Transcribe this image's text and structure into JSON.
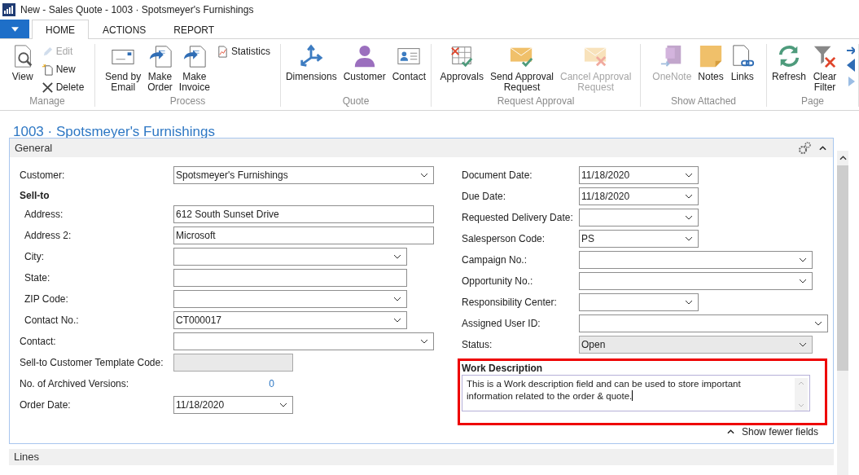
{
  "window": {
    "title": "New - Sales Quote - 1003 · Spotsmeyer's Furnishings"
  },
  "tabs": [
    {
      "label": "HOME",
      "selected": true
    },
    {
      "label": "ACTIONS",
      "selected": false
    },
    {
      "label": "REPORT",
      "selected": false
    }
  ],
  "ribbon": [
    {
      "label": "Manage",
      "items": [
        {
          "label": "View",
          "kind": "large",
          "disabled": false
        },
        {
          "label": "Edit",
          "kind": "small",
          "disabled": true
        },
        {
          "label": "New",
          "kind": "small",
          "disabled": false
        },
        {
          "label": "Delete",
          "kind": "small",
          "disabled": false
        }
      ]
    },
    {
      "label": "Process",
      "items": [
        {
          "label": "Send by\nEmail",
          "kind": "large",
          "disabled": false
        },
        {
          "label": "Make\nOrder",
          "kind": "large",
          "disabled": false
        },
        {
          "label": "Make\nInvoice",
          "kind": "large",
          "disabled": false
        },
        {
          "label": "Statistics",
          "kind": "small",
          "disabled": false
        }
      ]
    },
    {
      "label": "Quote",
      "items": [
        {
          "label": "Dimensions",
          "kind": "large",
          "disabled": false
        },
        {
          "label": "Customer",
          "kind": "large",
          "disabled": false
        },
        {
          "label": "Contact",
          "kind": "large",
          "disabled": false
        }
      ]
    },
    {
      "label": "Request Approval",
      "items": [
        {
          "label": "Approvals",
          "kind": "large",
          "disabled": false
        },
        {
          "label": "Send Approval\nRequest",
          "kind": "large",
          "disabled": false
        },
        {
          "label": "Cancel Approval\nRequest",
          "kind": "large",
          "disabled": true
        }
      ]
    },
    {
      "label": "Show Attached",
      "items": [
        {
          "label": "OneNote",
          "kind": "large",
          "disabled": true
        },
        {
          "label": "Notes",
          "kind": "large",
          "disabled": false
        },
        {
          "label": "Links",
          "kind": "large",
          "disabled": false
        }
      ]
    },
    {
      "label": "Page",
      "items": [
        {
          "label": "Refresh",
          "kind": "large",
          "disabled": false
        },
        {
          "label": "Clear\nFilter",
          "kind": "large",
          "disabled": false
        }
      ]
    }
  ],
  "page_title": "1003 · Spotsmeyer's Furnishings",
  "general": {
    "title": "General",
    "expanded": true,
    "left": [
      {
        "label": "Customer:",
        "value": "Spotsmeyer's Furnishings",
        "kind": "dropdown",
        "editable": true
      },
      {
        "label": "Sell-to",
        "kind": "heading",
        "children": [
          {
            "label": "Address:",
            "value": "612 South Sunset Drive",
            "kind": "text",
            "editable": true
          },
          {
            "label": "Address 2:",
            "value": "Microsoft",
            "kind": "text",
            "editable": true
          },
          {
            "label": "City:",
            "kind": "dropdown",
            "editable": true
          },
          {
            "label": "State:",
            "kind": "text",
            "editable": true
          },
          {
            "label": "ZIP Code:",
            "kind": "dropdown",
            "editable": true
          },
          {
            "label": "Contact No.:",
            "value": "CT000017",
            "kind": "dropdown",
            "editable": true
          }
        ]
      },
      {
        "label": "Contact:",
        "kind": "dropdown",
        "editable": true
      },
      {
        "label": "Sell-to Customer Template Code:",
        "kind": "text",
        "editable": false
      },
      {
        "label": "No. of Archived Versions:",
        "value": "0",
        "kind": "number",
        "editable": false
      },
      {
        "label": "Order Date:",
        "value": "11/18/2020",
        "kind": "dropdown",
        "editable": true
      }
    ],
    "right": [
      {
        "label": "Document Date:",
        "value": "11/18/2020",
        "kind": "dropdown",
        "editable": true
      },
      {
        "label": "Due Date:",
        "value": "11/18/2020",
        "kind": "dropdown",
        "editable": true
      },
      {
        "label": "Requested Delivery Date:",
        "kind": "dropdown",
        "editable": true
      },
      {
        "label": "Salesperson Code:",
        "value": "PS",
        "kind": "dropdown",
        "editable": true
      },
      {
        "label": "Campaign No.:",
        "kind": "dropdown",
        "editable": true
      },
      {
        "label": "Opportunity No.:",
        "kind": "dropdown",
        "editable": true
      },
      {
        "label": "Responsibility Center:",
        "kind": "dropdown",
        "editable": true
      },
      {
        "label": "Assigned User ID:",
        "kind": "dropdown",
        "editable": true
      },
      {
        "label": "Status:",
        "value": "Open",
        "kind": "dropdown",
        "editable": false
      }
    ],
    "work_description": {
      "label": "Work Description",
      "value": "This is a Work description field and can be used to store important information related to the order & quote.",
      "highlighted": true
    },
    "toggle": "Show fewer fields"
  },
  "lines": {
    "title": "Lines"
  }
}
